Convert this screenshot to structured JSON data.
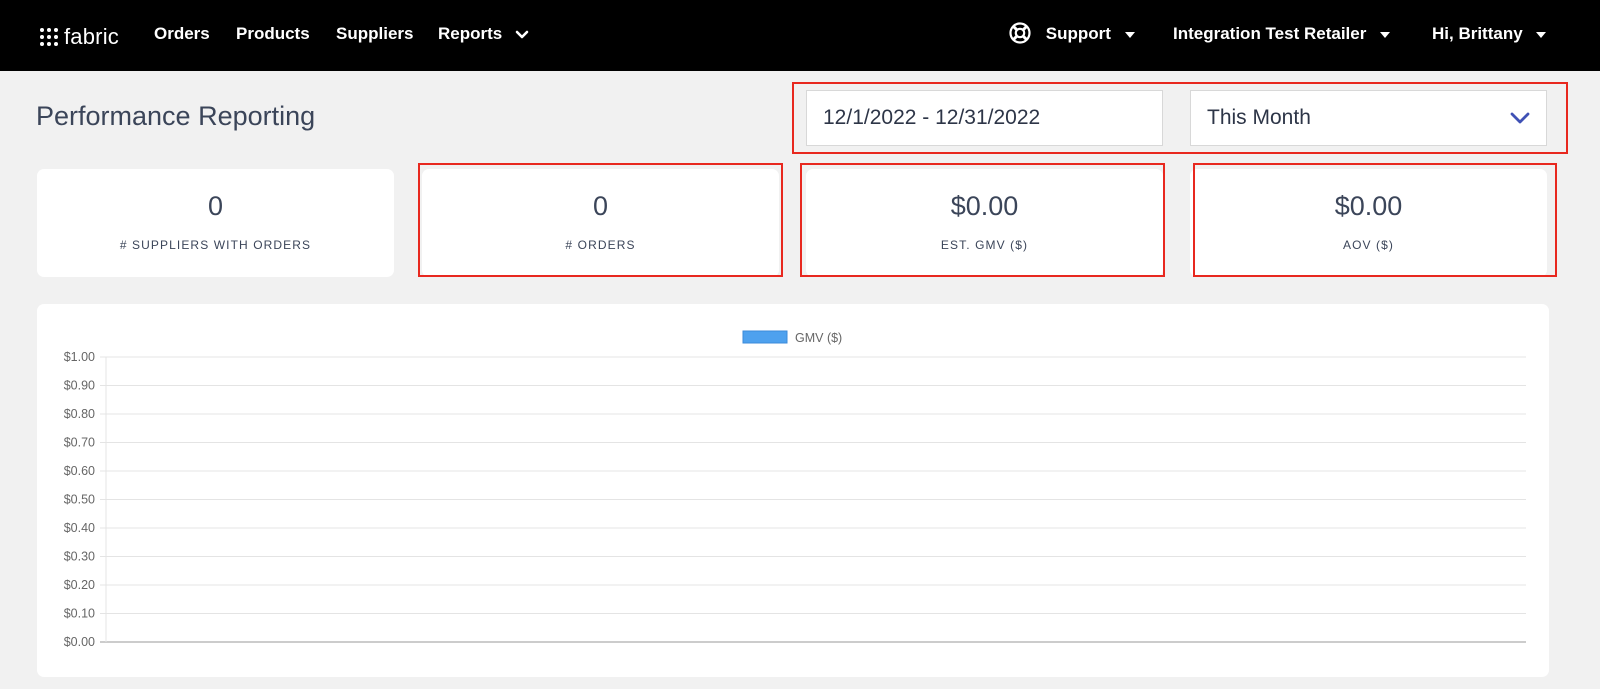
{
  "nav": {
    "logo": "fabric",
    "items": [
      {
        "label": "Orders"
      },
      {
        "label": "Products"
      },
      {
        "label": "Suppliers"
      },
      {
        "label": "Reports"
      }
    ],
    "support": "Support",
    "retailer": "Integration Test Retailer",
    "user": "Hi, Brittany"
  },
  "page": {
    "title": "Performance Reporting",
    "date_range": "12/1/2022 - 12/31/2022",
    "period_select": "This Month"
  },
  "stats": [
    {
      "value": "0",
      "label": "# SUPPLIERS WITH ORDERS"
    },
    {
      "value": "0",
      "label": "# ORDERS"
    },
    {
      "value": "$0.00",
      "label": "EST. GMV ($)"
    },
    {
      "value": "$0.00",
      "label": "AOV ($)"
    }
  ],
  "colors": {
    "nav_bg": "#000000",
    "page_bg": "#f1f1f1",
    "highlight": "#e8281f",
    "accent_chevron": "#3f51b5",
    "series": "#4ea1ee"
  },
  "chart_data": {
    "type": "bar",
    "categories": [],
    "series": [
      {
        "name": "GMV ($)",
        "values": []
      }
    ],
    "title": "",
    "xlabel": "",
    "ylabel": "",
    "ylim": [
      0,
      1
    ],
    "yticks": [
      "$0.00",
      "$0.10",
      "$0.20",
      "$0.30",
      "$0.40",
      "$0.50",
      "$0.60",
      "$0.70",
      "$0.80",
      "$0.90",
      "$1.00"
    ],
    "grid": true,
    "legend": "top-center"
  }
}
